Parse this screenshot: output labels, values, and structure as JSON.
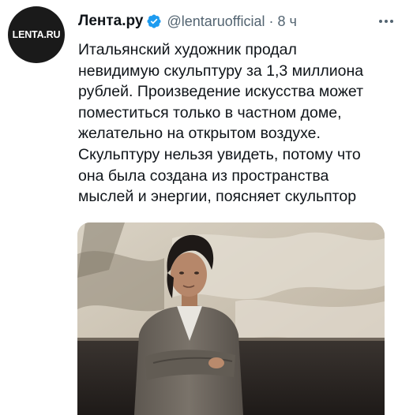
{
  "author": {
    "avatar_logo_text": "LENTA.RU",
    "display_name": "Лента.ру",
    "verified_icon": "verified-badge-icon",
    "handle": "@lentaruofficial",
    "separator": "·",
    "time": "8 ч"
  },
  "tweet": {
    "text_lines": [
      "Итальянский художник продал",
      "невидимую скульптуру за 1,3 миллиона",
      "рублей. Произведение искусства может",
      "поместиться только в частном доме,",
      "желательно на открытом воздухе.",
      "Скульптуру нельзя увидеть, потому что",
      "она была создана из пространства",
      "мыслей и энергии, поясняет скульптор"
    ]
  },
  "icons": {
    "more": "more-horizontal-icon"
  },
  "colors": {
    "text": "#0f1419",
    "secondary_text": "#536471",
    "verified": "#1d9bf0",
    "avatar_bg": "#1a1a1a"
  }
}
